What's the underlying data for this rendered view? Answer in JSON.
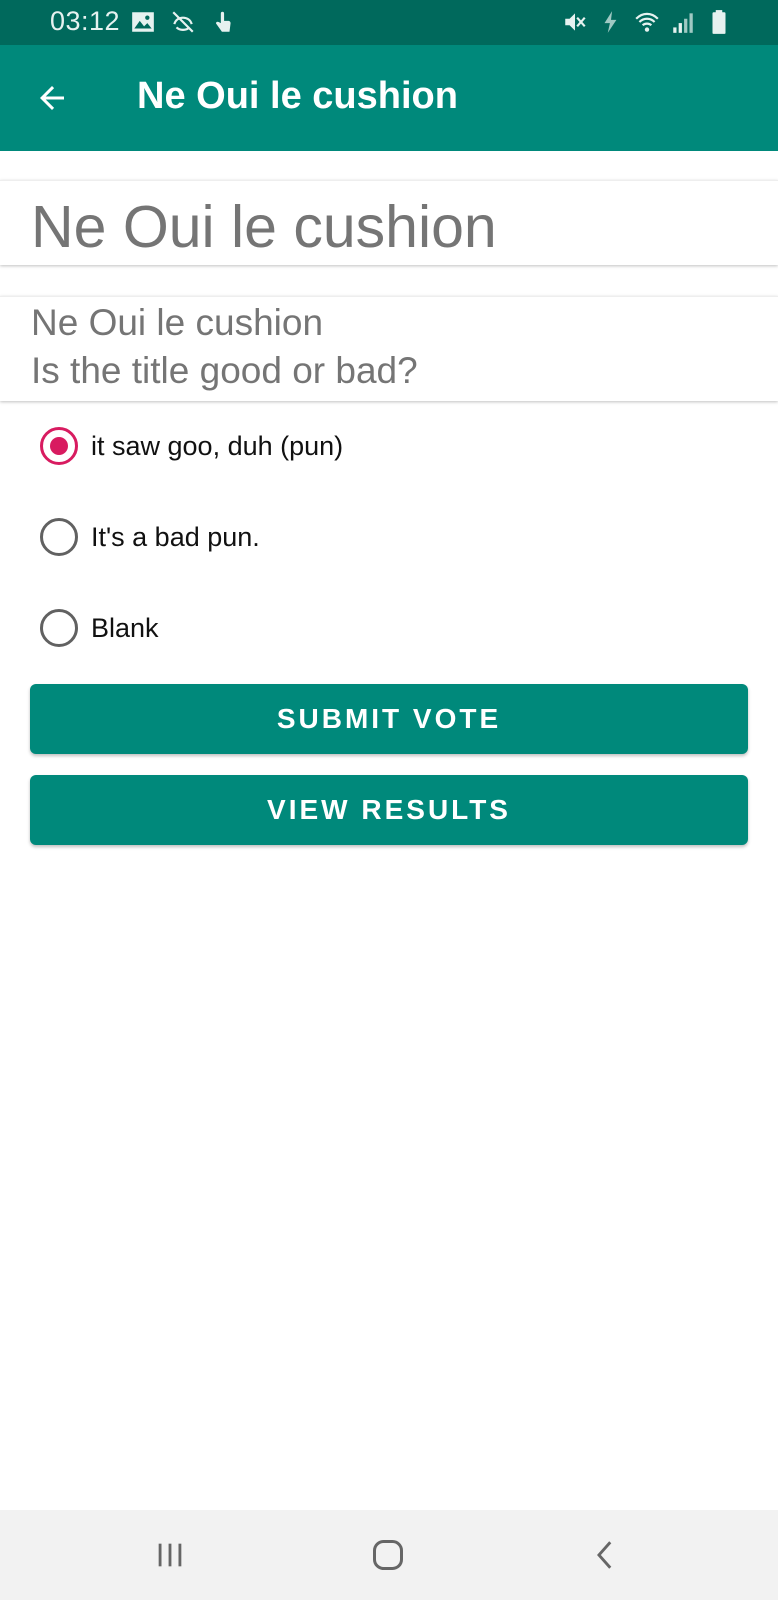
{
  "status_bar": {
    "time": "03:12",
    "icons_left": [
      "image-icon",
      "sync-off-icon",
      "touch-icon"
    ],
    "icons_right": [
      "mute-icon",
      "charging-icon",
      "wifi-icon",
      "signal-icon",
      "battery-icon"
    ]
  },
  "app_bar": {
    "title": "Ne Oui le cushion",
    "back_icon": "arrow-back-icon"
  },
  "poll": {
    "title": "Ne Oui le cushion",
    "question_line1": "Ne Oui le cushion",
    "question_line2": "Is the title good or bad?",
    "options": [
      {
        "label": "it saw goo, duh (pun)",
        "selected": true
      },
      {
        "label": "It's a bad pun.",
        "selected": false
      },
      {
        "label": "Blank",
        "selected": false
      }
    ]
  },
  "actions": {
    "submit_label": "SUBMIT VOTE",
    "results_label": "VIEW RESULTS"
  },
  "nav_bar": {
    "icons": [
      "recent-apps-icon",
      "home-icon",
      "back-icon"
    ]
  },
  "colors": {
    "status_bar": "#00695c",
    "primary": "#00897b",
    "accent": "#d81b60",
    "secondary_text": "#757575",
    "nav_bar": "#f2f2f2"
  }
}
